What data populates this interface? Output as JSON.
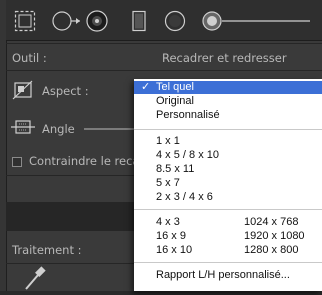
{
  "toolbar": {
    "tools": [
      {
        "name": "crop-overlay-icon"
      },
      {
        "name": "spot-removal-icon"
      },
      {
        "name": "red-eye-icon"
      },
      {
        "name": "graduated-filter-icon"
      },
      {
        "name": "radial-filter-icon"
      },
      {
        "name": "adjustment-brush-icon"
      }
    ]
  },
  "crop_panel": {
    "tool_label": "Outil :",
    "tool_value": "Recadrer et redresser",
    "aspect_label": "Aspect :",
    "angle_label": "Angle",
    "constrain_label": "Contraindre le recadrage"
  },
  "treatment": {
    "label": "Traitement :"
  },
  "aspect_menu": {
    "selected_check": "✓",
    "group1": [
      "Tel quel",
      "Original",
      "Personnalisé"
    ],
    "group2": [
      "1 x 1",
      "4 x 5  /  8 x 10",
      "8.5 x 11",
      "5 x 7",
      "2 x 3  /  4 x 6"
    ],
    "group3": [
      {
        "ratio": "4 x 3",
        "size": "1024 x 768"
      },
      {
        "ratio": "16 x 9",
        "size": "1920 x 1080"
      },
      {
        "ratio": "16 x 10",
        "size": "1280 x 800"
      }
    ],
    "custom": "Rapport L/H personnalisé..."
  },
  "colors": {
    "menu_highlight": "#3c6fd6",
    "panel_bg": "#3a3a3a"
  }
}
